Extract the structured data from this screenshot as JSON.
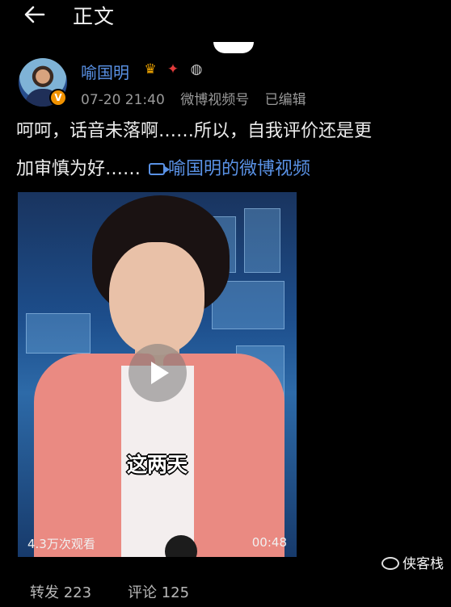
{
  "header": {
    "title": "正文",
    "back_icon": "back-arrow-icon"
  },
  "post": {
    "author": "喻国明",
    "date": "07-20 21:40",
    "source": "微博视频号",
    "edited": "已编辑",
    "text": "呵呵，话音未落啊……所以，自我评价还是更",
    "text_line2": "加审慎为好……",
    "video_link": "喻国明的微博视频",
    "verified_badge": "V"
  },
  "video": {
    "subtitle": "这两天",
    "views": "4.3万次观看",
    "duration": "00:48"
  },
  "footer": {
    "repost": "转发 223",
    "comment": "评论 125"
  },
  "watermark": "侠客栈"
}
